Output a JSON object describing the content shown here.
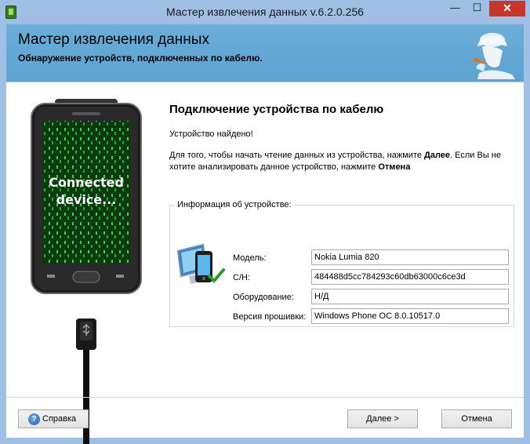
{
  "window": {
    "title": "Мастер извлечения данных v.6.2.0.256",
    "minimize": "—",
    "maximize": "☐",
    "close": "✕"
  },
  "banner": {
    "title": "Мастер извлечения данных",
    "subtitle": "Обнаружение устройств, подключенных по кабелю."
  },
  "phone_image": {
    "screen_text_line1": "Connected",
    "screen_text_line2": "device..."
  },
  "content": {
    "heading": "Подключение устройства по кабелю",
    "found": "Устройство найдено!",
    "instruction_before_next": "Для того, чтобы начать чтение данных из устройства, нажмите ",
    "next_word": "Далее",
    "instruction_middle": ". Если Вы не хотите анализировать данное устройство, нажмите ",
    "cancel_word": "Отмена"
  },
  "device_info": {
    "legend": "Информация об устройстве:",
    "model_label": "Модель:",
    "model_value": "Nokia Lumia 820",
    "serial_label": "С/Н:",
    "serial_value": "484488d5cc784293c60db63000c6ce3d",
    "hardware_label": "Оборудование:",
    "hardware_value": "Н/Д",
    "firmware_label": "Версия прошивки:",
    "firmware_value": "Windows Phone OC 8.0.10517.0"
  },
  "footer": {
    "help": "Справка",
    "help_icon": "?",
    "next": "Далее >",
    "cancel": "Отмена"
  },
  "colors": {
    "banner": "#5da3d2",
    "frame": "#9fc0e4",
    "close_button": "#c7352b",
    "matrix_green": "#1fae2c"
  }
}
